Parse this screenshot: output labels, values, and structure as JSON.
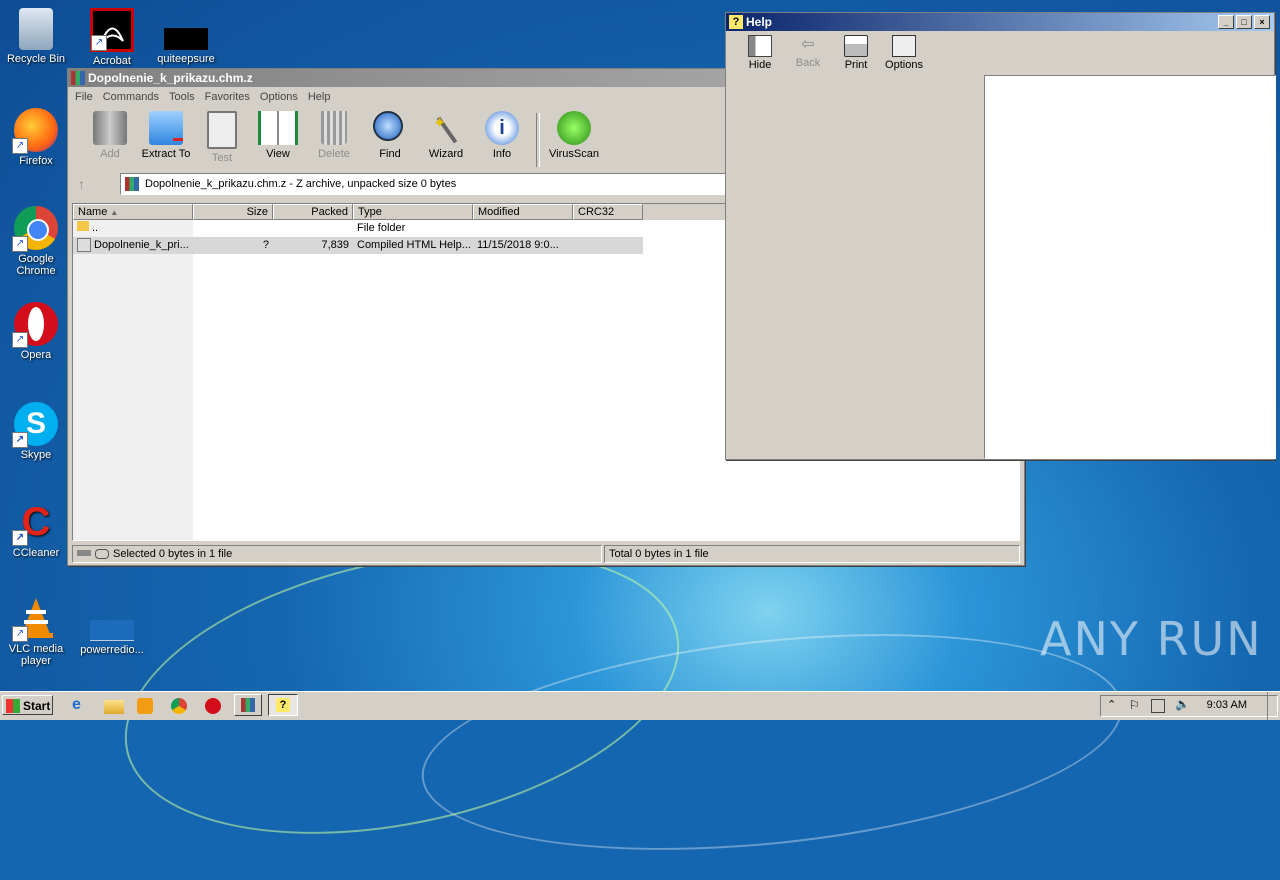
{
  "desktop": {
    "icons": [
      {
        "label": "Recycle Bin"
      },
      {
        "label": "Acrobat"
      },
      {
        "label": "quiteepsure"
      },
      {
        "label": "Firefox"
      },
      {
        "label": "Google Chrome"
      },
      {
        "label": "Opera"
      },
      {
        "label": "Skype"
      },
      {
        "label": "CCleaner"
      },
      {
        "label": "VLC media player"
      },
      {
        "label": "powerredio..."
      }
    ],
    "watermark": "ANY RUN"
  },
  "winrar": {
    "title": "Dopolnenie_k_prikazu.chm.z",
    "menu": [
      "File",
      "Commands",
      "Tools",
      "Favorites",
      "Options",
      "Help"
    ],
    "toolbar": [
      {
        "label": "Add",
        "icon": "add-archive-icon",
        "enabled": false
      },
      {
        "label": "Extract To",
        "icon": "extract-folder-icon",
        "enabled": true
      },
      {
        "label": "Test",
        "icon": "test-clipboard-icon",
        "enabled": false
      },
      {
        "label": "View",
        "icon": "view-book-icon",
        "enabled": true
      },
      {
        "label": "Delete",
        "icon": "trash-icon",
        "enabled": false
      },
      {
        "label": "Find",
        "icon": "magnifier-icon",
        "enabled": true
      },
      {
        "label": "Wizard",
        "icon": "wand-icon",
        "enabled": true
      },
      {
        "label": "Info",
        "icon": "info-icon",
        "enabled": true
      },
      {
        "label": "VirusScan",
        "icon": "virus-bug-icon",
        "enabled": true
      }
    ],
    "address": "Dopolnenie_k_prikazu.chm.z - Z archive, unpacked size 0 bytes",
    "columns": [
      "Name",
      "Size",
      "Packed",
      "Type",
      "Modified",
      "CRC32"
    ],
    "rows": [
      {
        "name": "..",
        "size": "",
        "packed": "",
        "type": "File folder",
        "modified": "",
        "crc": ""
      },
      {
        "name": "Dopolnenie_k_pri...",
        "size": "?",
        "packed": "7,839",
        "type": "Compiled HTML Help...",
        "modified": "11/15/2018 9:0...",
        "crc": ""
      }
    ],
    "status_left": "Selected 0 bytes in 1 file",
    "status_right": "Total 0 bytes in 1 file"
  },
  "help": {
    "title": "Help",
    "toolbar": [
      {
        "label": "Hide",
        "enabled": true
      },
      {
        "label": "Back",
        "enabled": false
      },
      {
        "label": "Print",
        "enabled": true
      },
      {
        "label": "Options",
        "enabled": true
      }
    ]
  },
  "taskbar": {
    "start": "Start",
    "clock": "9:03 AM"
  }
}
